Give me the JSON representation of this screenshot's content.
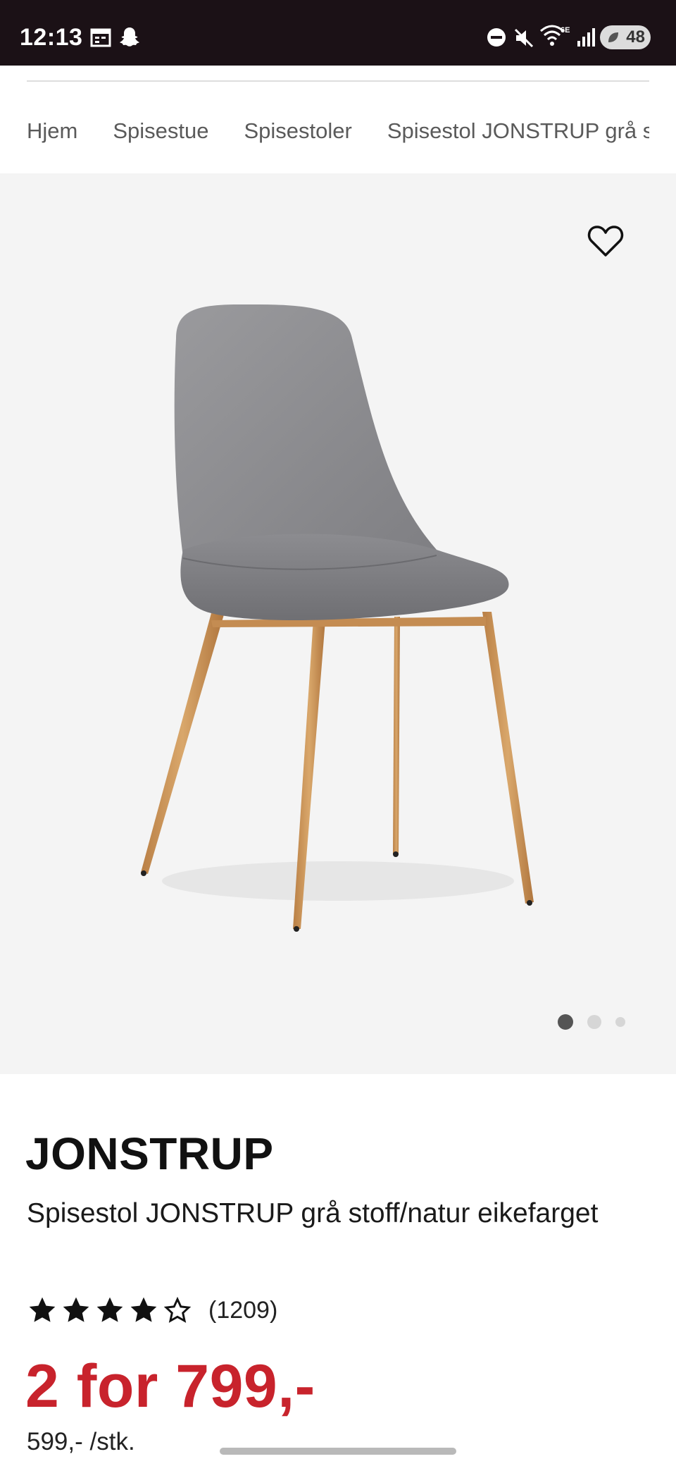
{
  "status_bar": {
    "time": "12:13",
    "network": "6E",
    "battery": "48",
    "icons": [
      "calendar-icon",
      "snapchat-icon",
      "dnd-icon",
      "mute-icon",
      "wifi-icon",
      "signal-icon",
      "battery-icon"
    ]
  },
  "breadcrumb": {
    "items": [
      "Hjem",
      "Spisestue",
      "Spisestoler",
      "Spisestol JONSTRUP grå stoff/natur eikefarget"
    ]
  },
  "gallery": {
    "image_count": 3,
    "active_index": 0,
    "favorite_icon": "heart-outline-icon"
  },
  "product": {
    "brand": "JONSTRUP",
    "name": "Spisestol JONSTRUP grå stoff/natur eikefarget",
    "rating": 4,
    "rating_max": 5,
    "review_count": "(1209)",
    "price": "2 for 799,-",
    "unit_price": "599,- /stk."
  },
  "colors": {
    "status_bar_bg": "#1b1116",
    "price_red": "#c8232c",
    "gallery_bg": "#f4f4f4",
    "chair_fabric": "#8e8e91",
    "chair_legs": "#c99558"
  }
}
